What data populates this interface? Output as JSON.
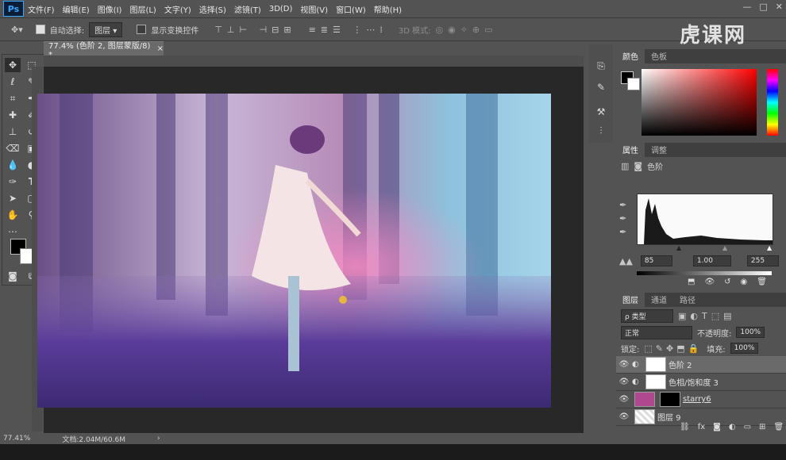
{
  "app": {
    "logo": "Ps"
  },
  "menu": [
    "文件(F)",
    "编辑(E)",
    "图像(I)",
    "图层(L)",
    "文字(Y)",
    "选择(S)",
    "滤镜(T)",
    "3D(D)",
    "视图(V)",
    "窗口(W)",
    "帮助(H)"
  ],
  "window_controls": [
    "—",
    "□",
    "✕"
  ],
  "options_bar": {
    "auto_select_label": "自动选择:",
    "auto_select_value": "图层",
    "show_transform_label": "显示变换控件",
    "mode_3d_label": "3D 模式:"
  },
  "watermark": "虎课网",
  "document_tab": {
    "title": "77.4% (色阶 2, 图层蒙版/8) *",
    "close": "×"
  },
  "status": {
    "zoom": "77.41%",
    "doc": "文档:2.04M/60.6M",
    "arrow": "›"
  },
  "color_panel": {
    "tabs": [
      "颜色",
      "色板"
    ],
    "hue_hex": "#ff0000"
  },
  "properties_panel": {
    "tabs": [
      "属性",
      "调整"
    ],
    "adjustment_name": "色阶",
    "input_black": "85",
    "input_gamma": "1.00",
    "input_white": "255"
  },
  "layers_panel": {
    "tabs": [
      "图层",
      "通道",
      "路径"
    ],
    "filter_kind": "ρ 类型",
    "blend_mode": "正常",
    "opacity_label": "不透明度:",
    "opacity_value": "100%",
    "lock_label": "锁定:",
    "fill_label": "填充:",
    "fill_value": "100%",
    "layers": [
      {
        "name": "色阶 2",
        "selected": true
      },
      {
        "name": "色相/饱和度 3",
        "selected": false
      },
      {
        "name": "starry6",
        "selected": false
      },
      {
        "name": "图层 9",
        "selected": false
      }
    ]
  },
  "colors": {
    "accent": "#31a8ff",
    "panel_bg": "#535353",
    "pasteboard": "#282828"
  }
}
